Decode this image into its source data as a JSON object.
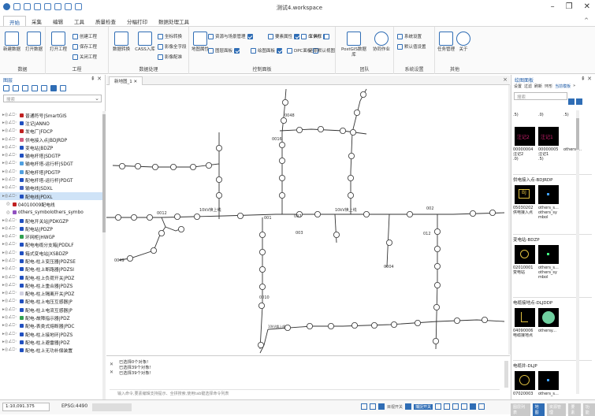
{
  "window": {
    "title": "测试4.workspace",
    "minimize": "–",
    "restore": "❐",
    "close": "✕",
    "ribbon_collapse": "^"
  },
  "menu": [
    "开始",
    "采集",
    "编辑",
    "工具",
    "质量检查",
    "分幅打印",
    "数据处理工具"
  ],
  "ribbon": {
    "data_group": {
      "name": "数据",
      "new_db": "新建数据",
      "open_db": "打开数据"
    },
    "project_group": {
      "name": "工程",
      "open_project": "打开工程",
      "create": "创建工程",
      "save": "保存工程",
      "close": "关闭工程"
    },
    "dataproc_group": {
      "name": "数据处理",
      "convert": "数据转换",
      "cass_import": "CASS入库",
      "coord_convert": "坐标转换",
      "layer_field": "影像全字段",
      "layer_config": "影像配准"
    },
    "control_group": {
      "name": "控制面板",
      "map_props": "地图属性",
      "layer_panel": "图层面板",
      "resource": "资源与场景管理",
      "element_props": "要素属性",
      "command": "命令行",
      "toolbar": "工具栏",
      "draw_panel": "绘图面板",
      "dpc_panel": "DPC面板",
      "restore_view": "还原默认视图"
    },
    "team_group": {
      "name": "团队",
      "postgis": "PostGIS数据库",
      "collab": "协同作业"
    },
    "sys_group": {
      "name": "系统设置",
      "sys_settings": "系统设置",
      "default_settings": "默认值设置"
    },
    "other_group": {
      "name": "其他",
      "task_mgmt": "任务管理",
      "about": "关于"
    }
  },
  "left_panel": {
    "title": "图层",
    "search_placeholder": "搜索",
    "layers": [
      {
        "label": "普通符号|SmartGIS",
        "color": "#c02020"
      },
      {
        "label": "注记|ANNO",
        "color": "#2050c0"
      },
      {
        "label": "发电厂|FDCP",
        "color": "#c02020"
      },
      {
        "label": "供电接入点|BDJRDP",
        "color": "#d06080"
      },
      {
        "label": "变电站|BDZP",
        "color": "#2050c0"
      },
      {
        "label": "输电杆塔|SDGTP",
        "color": "#2050c0"
      },
      {
        "label": "输电杆塔-运行杆|SDGT",
        "color": "#50a0e0"
      },
      {
        "label": "配电杆塔|PDGTP",
        "color": "#50a0e0"
      },
      {
        "label": "配电杆塔-运行杆|PDGT",
        "color": "#2050c0"
      },
      {
        "label": "输电线|SDXL",
        "color": "#4060c0"
      },
      {
        "label": "配电线|PDXL",
        "color": "#2050c0",
        "selected": true
      },
      {
        "label": "04010009配电线",
        "color": "#c02020",
        "sub": true
      },
      {
        "label": "others_symbolothers_symbo",
        "color": "#9050c0",
        "sub": true
      },
      {
        "label": "配电开关站|PDKGZP",
        "color": "#2050c0"
      },
      {
        "label": "配电站|PDZP",
        "color": "#2050c0"
      },
      {
        "label": "环网柜|HWGP",
        "color": "#30a050"
      },
      {
        "label": "配电电缆分支箱|PDDLF",
        "color": "#2050c0"
      },
      {
        "label": "箱式变电站|XSBDZP",
        "color": "#2050c0"
      },
      {
        "label": "配电-柱上变压器|PDZSE",
        "color": "#2050c0"
      },
      {
        "label": "配电-柱上断路器|PDZSI",
        "color": "#2050c0"
      },
      {
        "label": "配电-柱上负荷开关|PDZ",
        "color": "#2050c0"
      },
      {
        "label": "配电-柱上重合器|PDZS",
        "color": "#2050c0"
      },
      {
        "label": "配电-柱上隔离开关|PDZ",
        "color": "#d0d0e0"
      },
      {
        "label": "配电-柱上电压互感器|P",
        "color": "#2050c0"
      },
      {
        "label": "配电-柱上电流互感器|P",
        "color": "#2050c0"
      },
      {
        "label": "配电-故障指示器|PDZ",
        "color": "#30a050"
      },
      {
        "label": "配电-表类式熔断器|PDC",
        "color": "#2050c0"
      },
      {
        "label": "配电-柱上接地环|PDZS",
        "color": "#2050c0"
      },
      {
        "label": "配电-柱上避雷器|PDZ",
        "color": "#2050c0"
      },
      {
        "label": "配电-柱上无功补偿装置",
        "color": "#2050c0"
      }
    ]
  },
  "map": {
    "tab": "新地图_1",
    "close_tab": "✕",
    "close_view": "×",
    "labels": [
      "10kV焕上线",
      "10kV焕上线",
      "10kV焕上线",
      "001",
      "007",
      "002",
      "003",
      "012",
      "0012",
      "0004",
      "0010",
      "0049",
      "0048",
      "0016"
    ]
  },
  "console": {
    "lines": [
      "已选择0个对象!",
      "已选择39个对象!",
      "已选择39个对象!"
    ],
    "prompt": "输入命令,要素编辑支持提示、全拼搜索,使用tab键选择命令列表"
  },
  "right_panel": {
    "title": "绘图面板",
    "tabs": [
      "设置",
      "过滤",
      "刷新",
      "环形",
      "当前模板"
    ],
    "more": "»",
    "search_placeholder": "搜索",
    "top_row": [
      ".5)",
      ".0)",
      ".5)"
    ],
    "rows": [
      {
        "codes": [
          "00000004",
          "00000005",
          "othersy..."
        ],
        "names": [
          "注记2",
          "注记1",
          ""
        ],
        "extra": [
          ".0)",
          ".5)",
          ""
        ]
      },
      {
        "group": "供电接入点-BDJRDP",
        "codes": [
          "05030202",
          "others_s..."
        ],
        "names": [
          "供电接入点",
          "others_symbol"
        ]
      },
      {
        "group": "变电站-BDZP",
        "codes": [
          "02010001",
          "others_s..."
        ],
        "names": [
          "变电站",
          "others_symbol"
        ]
      },
      {
        "group": "电缆接地点-DLJDDP",
        "codes": [
          "04090006",
          "othersy..."
        ],
        "names": [
          "电缆接地点",
          ""
        ]
      },
      {
        "group": "电缆井-DLJP",
        "codes": [
          "07020003",
          "others_s..."
        ],
        "names": [
          "",
          ""
        ]
      }
    ],
    "symbol_text": [
      "注记2",
      "注记1",
      "BJ"
    ]
  },
  "status": {
    "scale": "1:10,091.375",
    "epsg": "EPSG:4490",
    "snap_label": "目视开关",
    "edge_label": "捕捉开关",
    "tabs": [
      "图层列表",
      "地图",
      "资源管理",
      "要素",
      "功能"
    ]
  }
}
